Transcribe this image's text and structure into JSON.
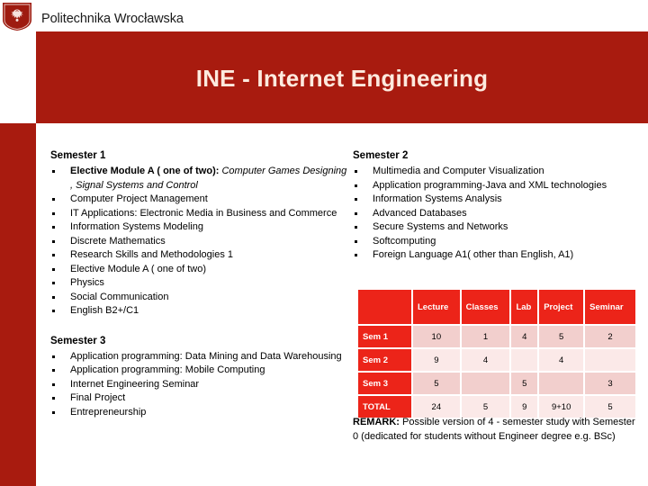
{
  "header": {
    "university": "Politechnika Wrocławska",
    "logo_icon": "wroclaw-university-shield-logo",
    "title": "INE - Internet Engineering"
  },
  "colors": {
    "banner_red": "#a81b0f",
    "table_header_red": "#ec2419",
    "row_shade_dark": "#f2cfcd",
    "row_shade_light": "#fbe9e8",
    "title_text": "#fdeade"
  },
  "semesters": [
    {
      "heading": "Semester 1",
      "courses": [
        {
          "bold": "Elective Module A ( one of two):",
          "italic": " Computer Games Designing , Signal Systems and Control"
        },
        {
          "text": "Computer Project Management"
        },
        {
          "text": "IT Applications: Electronic Media in Business and Commerce"
        },
        {
          "text": "Information  Systems Modeling"
        },
        {
          "text": "Discrete Mathematics"
        },
        {
          "text": "Research Skills and Methodologies 1"
        },
        {
          "text": "Elective Module A ( one of two)"
        },
        {
          "text": "Physics"
        },
        {
          "text": "Social Communication"
        },
        {
          "text": "English B2+/C1"
        }
      ]
    },
    {
      "heading": "Semester 3",
      "courses": [
        {
          "text": "Application programming: Data Mining and Data Warehousing"
        },
        {
          "text": "Application programming: Mobile Computing"
        },
        {
          "text": "Internet Engineering  Seminar"
        },
        {
          "text": "Final Project"
        },
        {
          "text": "Entrepreneurship"
        }
      ]
    },
    {
      "heading": "Semester 2",
      "courses": [
        {
          "text": "Multimedia and Computer Visualization"
        },
        {
          "text": "Application programming-Java and XML technologies"
        },
        {
          "text": "Information Systems Analysis"
        },
        {
          "text": "Advanced Databases"
        },
        {
          "text": "Secure Systems and Networks"
        },
        {
          "text": "Softcomputing"
        },
        {
          "text": "Foreign Language A1( other than English, A1)"
        }
      ]
    }
  ],
  "hours_table": {
    "columns": [
      "",
      "Lecture",
      "Classes",
      "Lab",
      "Project",
      "Seminar"
    ],
    "rows": [
      {
        "label": "Sem 1",
        "values": [
          "10",
          "1",
          "4",
          "5",
          "2"
        ]
      },
      {
        "label": "Sem 2",
        "values": [
          "9",
          "4",
          "",
          "4",
          ""
        ]
      },
      {
        "label": "Sem 3",
        "values": [
          "5",
          "",
          "5",
          "",
          "3"
        ]
      },
      {
        "label": "TOTAL",
        "values": [
          "24",
          "5",
          "9",
          "9+10",
          "5"
        ]
      }
    ]
  },
  "remark": {
    "label": "REMARK:",
    "text": " Possible version of  4 - semester study with Semester 0 (dedicated for students without Engineer degree e.g. BSc)"
  }
}
